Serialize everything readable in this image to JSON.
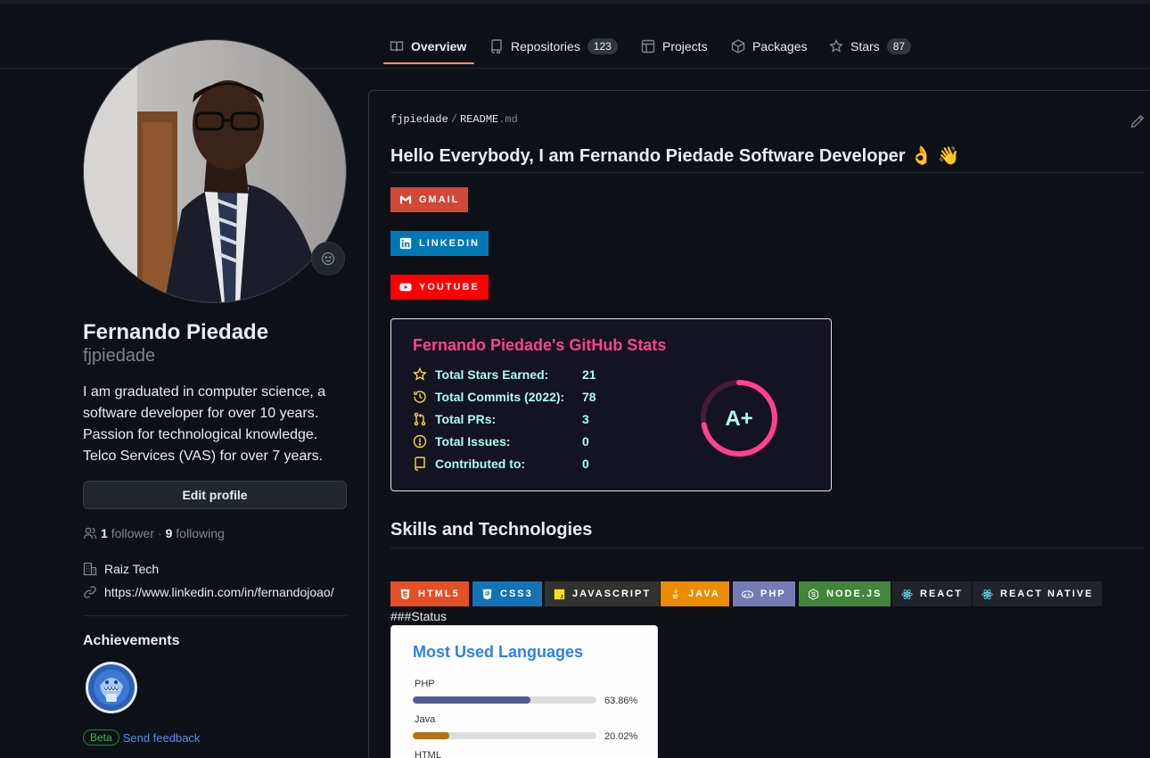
{
  "tabs": [
    {
      "label": "Overview",
      "icon": "book-icon"
    },
    {
      "label": "Repositories",
      "count": "123",
      "icon": "repo-icon"
    },
    {
      "label": "Projects",
      "icon": "table-icon"
    },
    {
      "label": "Packages",
      "icon": "package-icon"
    },
    {
      "label": "Stars",
      "count": "87",
      "icon": "star-icon"
    }
  ],
  "profile": {
    "name": "Fernando Piedade",
    "login": "fjpiedade",
    "bio": [
      "I am graduated in computer science, a",
      "software developer for over 10 years.",
      "Passion for technological knowledge.",
      "Telco Services (VAS) for over 7 years."
    ],
    "edit_label": "Edit profile",
    "followers_count": "1",
    "followers_label": "follower",
    "dot": "·",
    "following_count": "9",
    "following_label": "following",
    "company": "Raiz Tech",
    "website": "https://www.linkedin.com/in/fernandojoao/",
    "achievements_title": "Achievements",
    "beta_label": "Beta",
    "feedback_label": "Send feedback"
  },
  "readme": {
    "owner": "fjpiedade",
    "sep": "/",
    "file": "README",
    "ext": ".md",
    "heading": "Hello Everybody, I am Fernando Piedade Software Developer 👌 👋",
    "social": [
      {
        "label": "GMAIL",
        "color": "#D14836"
      },
      {
        "label": "LINKEDIN",
        "color": "#0077B5"
      },
      {
        "label": "YOUTUBE",
        "color": "#FF0000"
      }
    ],
    "skills_heading": "Skills and Technologies",
    "skills": [
      {
        "label": "HTML5",
        "color": "#E34F26"
      },
      {
        "label": "CSS3",
        "color": "#1572B6"
      },
      {
        "label": "JAVASCRIPT",
        "color": "#323330"
      },
      {
        "label": "JAVA",
        "color": "#ED8B00"
      },
      {
        "label": "PHP",
        "color": "#777BB4"
      },
      {
        "label": "NODE.JS",
        "color": "#43853D"
      },
      {
        "label": "REACT",
        "color": "#20232A"
      },
      {
        "label": "REACT NATIVE",
        "color": "#20232A"
      }
    ],
    "status_text": "###Status"
  },
  "stats_card": {
    "title": "Fernando Piedade's GitHub Stats",
    "rows": [
      {
        "label": "Total Stars Earned:",
        "value": "21",
        "icon": "star-icon"
      },
      {
        "label": "Total Commits (2022):",
        "value": "78",
        "icon": "history-icon"
      },
      {
        "label": "Total PRs:",
        "value": "3",
        "icon": "pull-request-icon"
      },
      {
        "label": "Total Issues:",
        "value": "0",
        "icon": "issue-icon"
      },
      {
        "label": "Contributed to:",
        "value": "0",
        "icon": "repo-icon"
      }
    ],
    "rank": "A+",
    "rank_progress": 0.72,
    "colors": {
      "bg": "#141321",
      "title": "#fe428e",
      "text": "#a9fef7",
      "icon": "#f8d847",
      "ring": "#fe428e"
    }
  },
  "languages_card": {
    "title": "Most Used Languages",
    "languages": [
      {
        "name": "PHP",
        "percent_label": "63.86%",
        "percent": 63.86,
        "color": "#4F5D95"
      },
      {
        "name": "Java",
        "percent_label": "20.02%",
        "percent": 20.02,
        "color": "#b07219"
      },
      {
        "name": "HTML",
        "percent_label": "",
        "percent": 0,
        "color": "#e34c26"
      }
    ]
  }
}
